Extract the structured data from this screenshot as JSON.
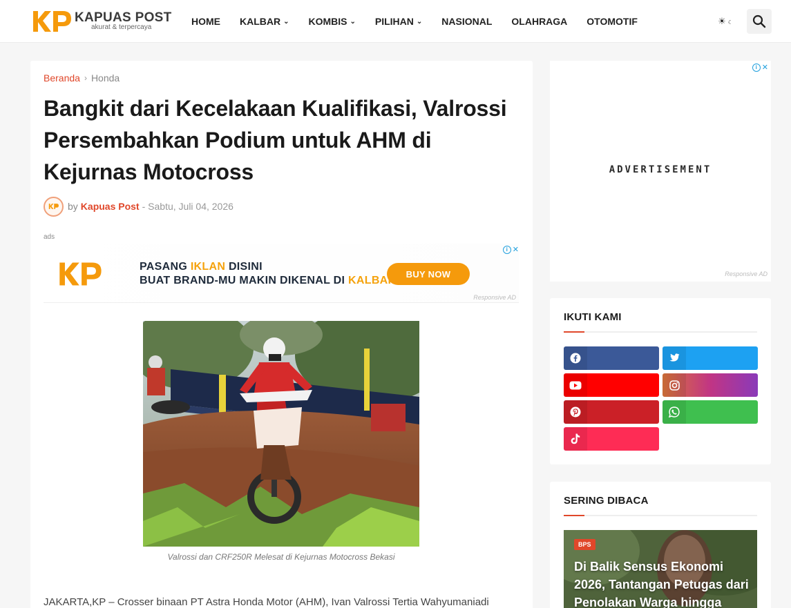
{
  "site": {
    "logo_initials": "KP",
    "name": "KAPUAS POST",
    "tagline": "akurat & terpercaya",
    "brand_color": "#f59a0c"
  },
  "nav": {
    "items": [
      {
        "label": "HOME",
        "dropdown": false
      },
      {
        "label": "KALBAR",
        "dropdown": true
      },
      {
        "label": "KOMBIS",
        "dropdown": true
      },
      {
        "label": "PILIHAN",
        "dropdown": true
      },
      {
        "label": "NASIONAL",
        "dropdown": false
      },
      {
        "label": "OLAHRAGA",
        "dropdown": false
      },
      {
        "label": "OTOMOTIF",
        "dropdown": false
      }
    ],
    "theme_icon": "sun-moon-icon",
    "search_icon": "search-icon"
  },
  "breadcrumb": {
    "home": "Beranda",
    "category": "Honda"
  },
  "post": {
    "title": "Bangkit dari Kecelakaan Kualifikasi, Valrossi Persembahkan Podium untuk AHM di Kejurnas Motocross",
    "by": "by",
    "author": "Kapuas Post",
    "date": "- Sabtu, Juli 04, 2026",
    "ads_label": "ads",
    "image_caption": "Valrossi dan CRF250R Melesat di Kejurnas Motocross Bekasi",
    "body_first_line": "JAKARTA,KP – Crosser binaan PT Astra Honda Motor (AHM), Ivan Valrossi Tertia Wahyumaniadi"
  },
  "banner_ad": {
    "logo": "KP",
    "line1_a": "PASANG ",
    "line1_hl": "IKLAN",
    "line1_b": " DISINI",
    "line2_a": "BUAT BRAND-MU MAKIN DIKENAL DI ",
    "line2_hl": "KALBAR",
    "button": "BUY NOW",
    "responsive_label": "Responsive AD"
  },
  "side_ad": {
    "text": "ADVERTISEMENT",
    "responsive_label": "Responsive AD"
  },
  "follow_widget": {
    "title": "IKUTI KAMI",
    "buttons": [
      {
        "network": "facebook",
        "icon": "facebook-icon",
        "color": "#3b5998"
      },
      {
        "network": "twitter",
        "icon": "twitter-icon",
        "color": "#1da1f2"
      },
      {
        "network": "youtube",
        "icon": "youtube-icon",
        "color": "#ff0000"
      },
      {
        "network": "instagram",
        "icon": "instagram-icon",
        "color": "#c13584"
      },
      {
        "network": "pinterest",
        "icon": "pinterest-icon",
        "color": "#cb2027"
      },
      {
        "network": "whatsapp",
        "icon": "whatsapp-icon",
        "color": "#3fbf4f"
      },
      {
        "network": "tiktok",
        "icon": "tiktok-icon",
        "color": "#fe2c55"
      }
    ]
  },
  "popular_widget": {
    "title": "SERING DIBACA",
    "first_item": {
      "badge": "BPS",
      "title": "Di Balik Sensus Ekonomi 2026, Tantangan Petugas dari Penolakan Warga hingga"
    }
  }
}
